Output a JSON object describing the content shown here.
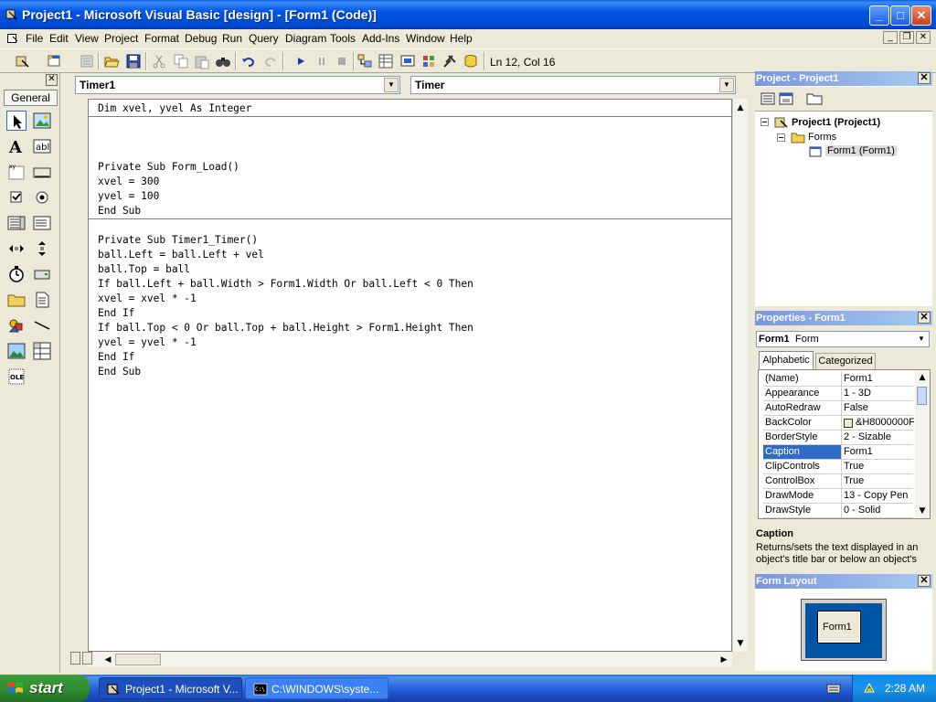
{
  "window": {
    "title": "Project1 - Microsoft Visual Basic [design] - [Form1 (Code)]",
    "buttons": {
      "minimize": "_",
      "maximize": "□",
      "close": "✕"
    }
  },
  "menubar": {
    "items": [
      "File",
      "Edit",
      "View",
      "Project",
      "Format",
      "Debug",
      "Run",
      "Query",
      "Diagram",
      "Tools",
      "Add-Ins",
      "Window",
      "Help"
    ]
  },
  "toolbar": {
    "position": "Ln 12, Col 16"
  },
  "toolbox": {
    "tab_label": "General"
  },
  "code_window": {
    "object_combo": "Timer1",
    "procedure_combo": "Timer",
    "lines": [
      "Dim xvel, yvel As Integer",
      "Private Sub Form_Load()",
      "xvel = 300",
      "yvel = 100",
      "End Sub",
      "Private Sub Timer1_Timer()",
      "ball.Left = ball.Left + vel",
      "ball.Top = ball",
      "If ball.Left + ball.Width > Form1.Width Or ball.Left < 0 Then",
      "xvel = xvel * -1",
      "End If",
      "If ball.Top < 0 Or ball.Top + ball.Height > Form1.Height Then",
      "yvel = yvel * -1",
      "End If",
      "End Sub"
    ]
  },
  "project_panel": {
    "title": "Project - Project1",
    "tree": {
      "project": "Project1 (Project1)",
      "folder": "Forms",
      "form": "Form1 (Form1)"
    }
  },
  "properties_panel": {
    "title": "Properties - Form1",
    "object_name": "Form1",
    "object_type": "Form",
    "tabs": [
      "Alphabetic",
      "Categorized"
    ],
    "rows": [
      {
        "name": "(Name)",
        "value": "Form1"
      },
      {
        "name": "Appearance",
        "value": "1 - 3D"
      },
      {
        "name": "AutoRedraw",
        "value": "False"
      },
      {
        "name": "BackColor",
        "value": "&H8000000F"
      },
      {
        "name": "BorderStyle",
        "value": "2 - Sizable"
      },
      {
        "name": "Caption",
        "value": "Form1"
      },
      {
        "name": "ClipControls",
        "value": "True"
      },
      {
        "name": "ControlBox",
        "value": "True"
      },
      {
        "name": "DrawMode",
        "value": "13 - Copy Pen"
      },
      {
        "name": "DrawStyle",
        "value": "0 - Solid"
      }
    ],
    "description_title": "Caption",
    "description_text": "Returns/sets the text displayed in an object's title bar or below an object's"
  },
  "form_layout_panel": {
    "title": "Form Layout",
    "form_label": "Form1"
  },
  "taskbar": {
    "start_label": "start",
    "tasks": [
      "Project1 - Microsoft V...",
      "C:\\WINDOWS\\syste..."
    ],
    "clock": "2:28 AM"
  }
}
